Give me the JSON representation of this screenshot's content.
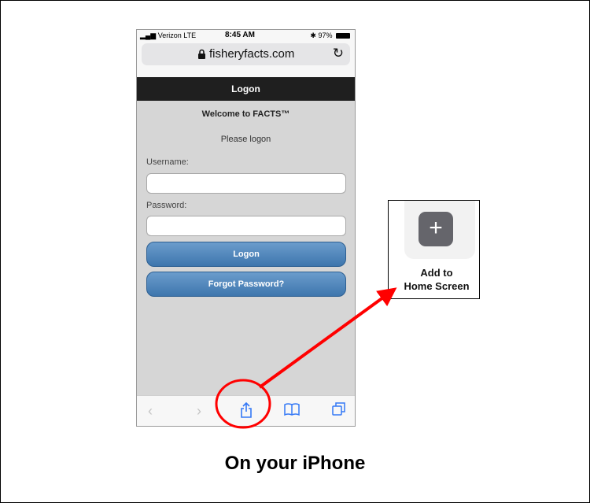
{
  "status_bar": {
    "carrier": "Verizon  LTE",
    "time": "8:45 AM",
    "battery": "97%"
  },
  "url_bar": {
    "domain": "fisheryfacts.com"
  },
  "page": {
    "title": "Logon",
    "welcome": "Welcome to FACTS™",
    "prompt": "Please logon",
    "username_label": "Username:",
    "password_label": "Password:",
    "username_value": "",
    "password_value": "",
    "logon_button": "Logon",
    "forgot_button": "Forgot Password?"
  },
  "toolbar": {
    "icons": [
      "back-icon",
      "forward-icon",
      "share-icon",
      "bookmarks-icon",
      "tabs-icon"
    ]
  },
  "callout": {
    "line1": "Add to",
    "line2": "Home Screen",
    "icon": "plus-icon"
  },
  "caption": "On your iPhone",
  "colors": {
    "arrow": "#ff0000",
    "button": "#4a80b8",
    "titlebar": "#1f1f1f"
  }
}
